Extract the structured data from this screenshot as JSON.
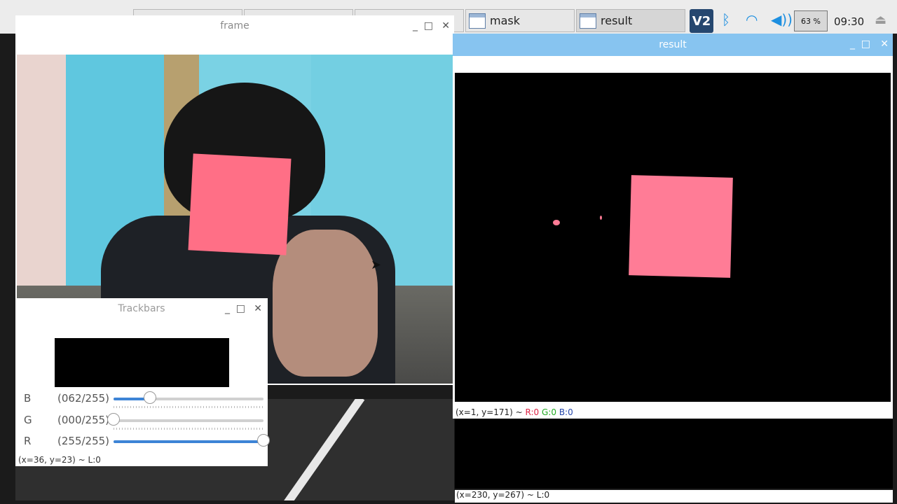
{
  "taskbar": {
    "tabs": [
      {
        "label": "mask",
        "active": false
      },
      {
        "label": "result",
        "active": true
      }
    ],
    "vnc_label": "V2",
    "cpu_label": "63 %",
    "clock": "09:30",
    "icons": [
      "vnc-icon",
      "bluetooth-icon",
      "wifi-icon",
      "volume-icon",
      "eject-icon"
    ]
  },
  "frame_window": {
    "title": "frame",
    "minimize": "_",
    "maximize": "□",
    "close": "✕"
  },
  "result_window": {
    "title": "result",
    "minimize": "_",
    "maximize": "□",
    "close": "✕",
    "status_prefix": "(x=1, y=171) ~ ",
    "status_r": "R:0",
    "status_g": "G:0",
    "status_b": "B:0"
  },
  "mask_window": {
    "status": "(x=230, y=267) ~ L:0"
  },
  "trackbars_window": {
    "title": "Trackbars",
    "minimize": "_",
    "maximize": "□",
    "close": "✕",
    "rows": [
      {
        "channel": "B",
        "value": "(062/255)",
        "level": 62
      },
      {
        "channel": "G",
        "value": "(000/255)",
        "level": 0
      },
      {
        "channel": "R",
        "value": "(255/255)",
        "level": 255
      }
    ],
    "max": 255,
    "status": "(x=36, y=23) ~ L:0"
  },
  "colors": {
    "accent": "#3d84d6",
    "card_pink": "#ff7c96",
    "result_titlebar": "#87c4f0"
  }
}
